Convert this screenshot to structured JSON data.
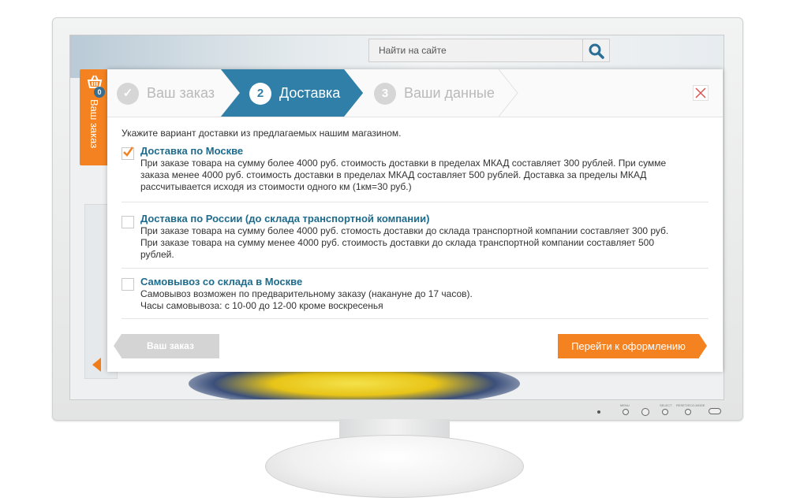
{
  "site": {
    "search_placeholder": "Найти на сайте"
  },
  "cart": {
    "label": "Ваш заказ",
    "count": "0"
  },
  "steps": [
    {
      "number": "✓",
      "label": "Ваш заказ",
      "state": "done"
    },
    {
      "number": "2",
      "label": "Доставка",
      "state": "active"
    },
    {
      "number": "3",
      "label": "Ваши данные",
      "state": "pending"
    }
  ],
  "colors": {
    "accent": "#f58220",
    "active_step": "#2f7fa8",
    "title_link": "#1e6b8c"
  },
  "delivery": {
    "intro": "Укажите вариант доставки из предлагаемых нашим магазином.",
    "options": [
      {
        "title": "Доставка по Москве",
        "checked": true,
        "lines": [
          "При заказе товара на сумму более 4000 руб. стоимость доставки в пределах МКАД составляет 300 рублей. При сумме",
          "заказа менее 4000 руб. стоимость доставки в пределах МКАД составляет 500 рублей. Доставка за пределы МКАД",
          "рассчитывается исходя из стоимости одного км (1км=30 руб.)"
        ]
      },
      {
        "title": "Доставка по России (до склада транспортной компании)",
        "checked": false,
        "lines": [
          "При заказе товара на сумму более 4000 руб. стомость доставки до склада транспортной компании составляет 300 руб.",
          "При заказе товара на сумму менее 4000 руб. стоимость доставки до склада транспортной компании составляет 500",
          "рублей."
        ]
      },
      {
        "title": "Самовывоз со склада в Москве",
        "checked": false,
        "lines": [
          "Самовывоз возможен по предварительному заказу (накануне до 17 часов).",
          "Часы самовывоза: с 10-00 до 12-00 кроме воскресенья"
        ]
      }
    ]
  },
  "buttons": {
    "back": "Ваш заказ",
    "next": "Перейти к оформлению"
  },
  "monitor": {
    "labels": [
      "MENU",
      "SELECT",
      "RESET/ECO-MODE"
    ]
  }
}
